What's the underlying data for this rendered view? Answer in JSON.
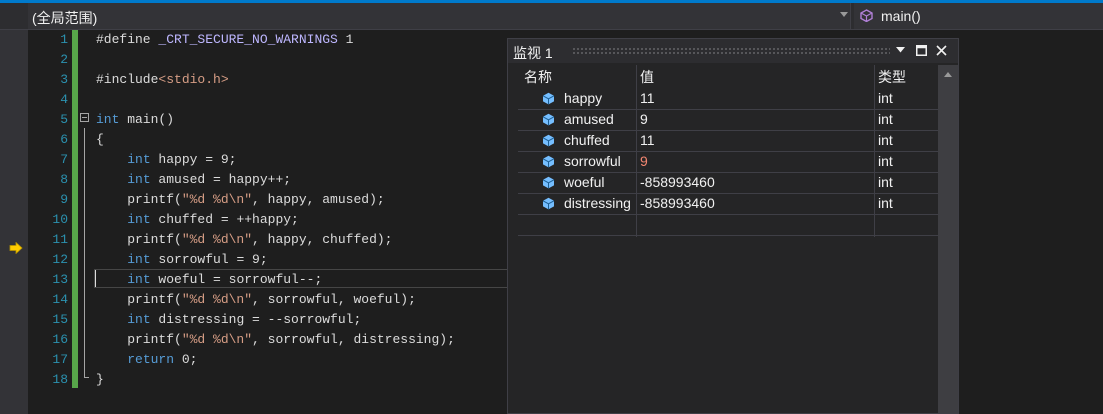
{
  "navbar": {
    "scope": "(全局范围)",
    "function": "main()"
  },
  "editor": {
    "lines": [
      {
        "n": "1",
        "tokens": [
          {
            "t": "#define ",
            "c": ""
          },
          {
            "t": "_CRT_SECURE_NO_WARNINGS",
            "c": "mac"
          },
          {
            "t": " 1",
            "c": ""
          }
        ]
      },
      {
        "n": "2",
        "tokens": []
      },
      {
        "n": "3",
        "tokens": [
          {
            "t": "#include",
            "c": ""
          },
          {
            "t": "<stdio.h>",
            "c": "inc"
          }
        ]
      },
      {
        "n": "4",
        "tokens": []
      },
      {
        "n": "5",
        "tokens": [
          {
            "t": "int",
            "c": "kw"
          },
          {
            "t": " main()",
            "c": ""
          }
        ]
      },
      {
        "n": "6",
        "tokens": [
          {
            "t": "{",
            "c": ""
          }
        ]
      },
      {
        "n": "7",
        "tokens": [
          {
            "t": "    ",
            "c": ""
          },
          {
            "t": "int",
            "c": "kw"
          },
          {
            "t": " happy = 9;",
            "c": ""
          }
        ]
      },
      {
        "n": "8",
        "tokens": [
          {
            "t": "    ",
            "c": ""
          },
          {
            "t": "int",
            "c": "kw"
          },
          {
            "t": " amused = happy++;",
            "c": ""
          }
        ]
      },
      {
        "n": "9",
        "tokens": [
          {
            "t": "    printf(",
            "c": ""
          },
          {
            "t": "\"%d %d\\n\"",
            "c": "str"
          },
          {
            "t": ", happy, amused);",
            "c": ""
          }
        ]
      },
      {
        "n": "10",
        "tokens": [
          {
            "t": "    ",
            "c": ""
          },
          {
            "t": "int",
            "c": "kw"
          },
          {
            "t": " chuffed = ++happy;",
            "c": ""
          }
        ]
      },
      {
        "n": "11",
        "tokens": [
          {
            "t": "    printf(",
            "c": ""
          },
          {
            "t": "\"%d %d\\n\"",
            "c": "str"
          },
          {
            "t": ", happy, chuffed);",
            "c": ""
          }
        ]
      },
      {
        "n": "12",
        "tokens": [
          {
            "t": "    ",
            "c": ""
          },
          {
            "t": "int",
            "c": "kw"
          },
          {
            "t": " sorrowful = 9;",
            "c": ""
          }
        ]
      },
      {
        "n": "13",
        "tokens": [
          {
            "t": "    ",
            "c": ""
          },
          {
            "t": "int",
            "c": "kw"
          },
          {
            "t": " woeful = sorrowful--;",
            "c": ""
          }
        ]
      },
      {
        "n": "14",
        "tokens": [
          {
            "t": "    printf(",
            "c": ""
          },
          {
            "t": "\"%d %d\\n\"",
            "c": "str"
          },
          {
            "t": ", sorrowful, woeful);",
            "c": ""
          }
        ]
      },
      {
        "n": "15",
        "tokens": [
          {
            "t": "    ",
            "c": ""
          },
          {
            "t": "int",
            "c": "kw"
          },
          {
            "t": " distressing = --sorrowful;",
            "c": ""
          }
        ]
      },
      {
        "n": "16",
        "tokens": [
          {
            "t": "    printf(",
            "c": ""
          },
          {
            "t": "\"%d %d\\n\"",
            "c": "str"
          },
          {
            "t": ", sorrowful, distressing);",
            "c": ""
          }
        ]
      },
      {
        "n": "17",
        "tokens": [
          {
            "t": "    ",
            "c": ""
          },
          {
            "t": "return",
            "c": "kw"
          },
          {
            "t": " 0;",
            "c": ""
          }
        ]
      },
      {
        "n": "18",
        "tokens": [
          {
            "t": "}",
            "c": ""
          }
        ]
      }
    ]
  },
  "watch": {
    "title": "监视 1",
    "columns": {
      "name": "名称",
      "value": "值",
      "type": "类型"
    },
    "rows": [
      {
        "name": "happy",
        "value": "11",
        "type": "int",
        "changed": false
      },
      {
        "name": "amused",
        "value": "9",
        "type": "int",
        "changed": false
      },
      {
        "name": "chuffed",
        "value": "11",
        "type": "int",
        "changed": false
      },
      {
        "name": "sorrowful",
        "value": "9",
        "type": "int",
        "changed": true
      },
      {
        "name": "woeful",
        "value": "-858993460",
        "type": "int",
        "changed": false
      },
      {
        "name": "distressing",
        "value": "-858993460",
        "type": "int",
        "changed": false
      }
    ]
  },
  "colors": {
    "accent": "#007acc",
    "keyword": "#569cd6",
    "string": "#d69d85",
    "changed_value": "#f48771",
    "line_number": "#2b91af"
  }
}
